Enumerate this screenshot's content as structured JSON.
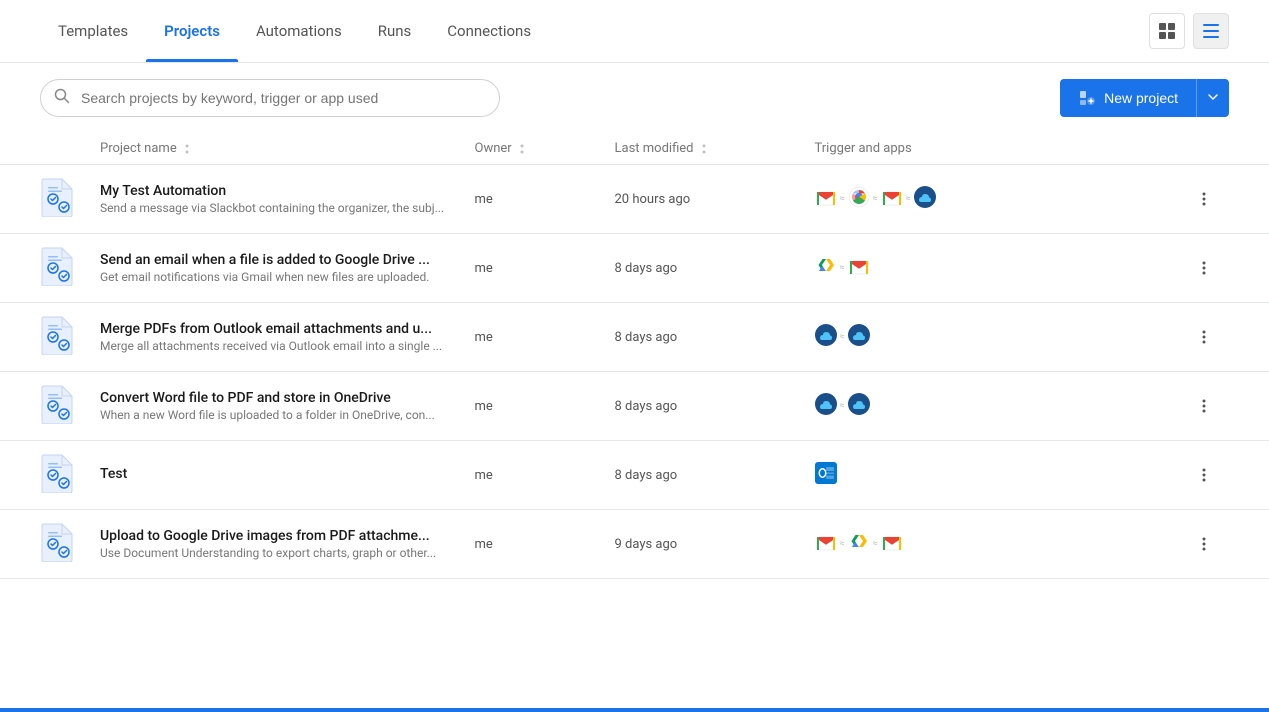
{
  "nav": {
    "tabs": [
      {
        "id": "templates",
        "label": "Templates",
        "active": false
      },
      {
        "id": "projects",
        "label": "Projects",
        "active": true
      },
      {
        "id": "automations",
        "label": "Automations",
        "active": false
      },
      {
        "id": "runs",
        "label": "Runs",
        "active": false
      },
      {
        "id": "connections",
        "label": "Connections",
        "active": false
      }
    ]
  },
  "toolbar": {
    "search_placeholder": "Search projects by keyword, trigger or app used",
    "new_project_label": "New project"
  },
  "table": {
    "columns": {
      "name": "Project name",
      "owner": "Owner",
      "modified": "Last modified",
      "trigger": "Trigger and apps"
    },
    "rows": [
      {
        "id": 1,
        "name": "My Test Automation",
        "desc": "Send a message via Slackbot containing the organizer, the subj...",
        "owner": "me",
        "modified": "20 hours ago",
        "apps": [
          "gmail",
          "chrome",
          "gmail2",
          "cloud"
        ]
      },
      {
        "id": 2,
        "name": "Send an email when a file is added to Google Drive ...",
        "desc": "Get email notifications via Gmail when new files are uploaded.",
        "owner": "me",
        "modified": "8 days ago",
        "apps": [
          "gdrive",
          "gmail"
        ]
      },
      {
        "id": 3,
        "name": "Merge PDFs from Outlook email attachments and u...",
        "desc": "Merge all attachments received via Outlook email into a single ...",
        "owner": "me",
        "modified": "8 days ago",
        "apps": [
          "cloud",
          "cloud2"
        ]
      },
      {
        "id": 4,
        "name": "Convert Word file to PDF and store in OneDrive",
        "desc": "When a new Word file is uploaded to a folder in OneDrive, con...",
        "owner": "me",
        "modified": "8 days ago",
        "apps": [
          "cloud",
          "cloud2"
        ]
      },
      {
        "id": 5,
        "name": "Test",
        "desc": "",
        "owner": "me",
        "modified": "8 days ago",
        "apps": [
          "outlook"
        ]
      },
      {
        "id": 6,
        "name": "Upload to Google Drive images from PDF attachme...",
        "desc": "Use Document Understanding to export charts, graph or other...",
        "owner": "me",
        "modified": "9 days ago",
        "apps": [
          "gmail",
          "gdrive",
          "gmail2"
        ]
      }
    ]
  }
}
